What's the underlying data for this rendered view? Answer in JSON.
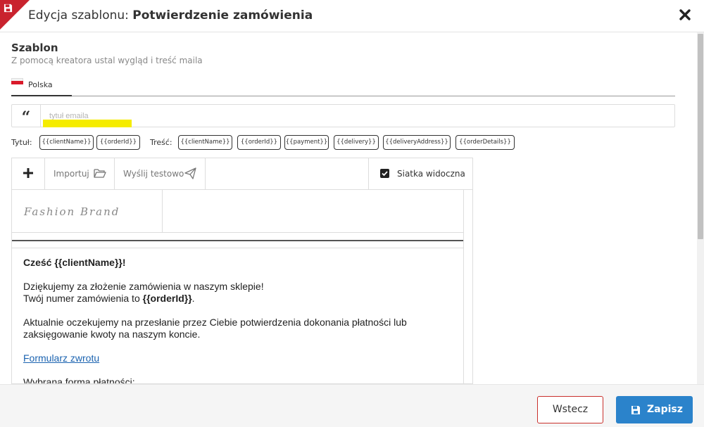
{
  "header": {
    "title_prefix": "Edycja szablonu:",
    "title_name": "Potwierdzenie zamówienia",
    "corner_icon": "save-icon",
    "close_icon": "close-icon"
  },
  "section": {
    "title": "Szablon",
    "subtitle": "Z pomocą kreatora ustal wygląd i treść maila"
  },
  "tabs": [
    {
      "label": "Polska",
      "flag": "flag-pl-icon",
      "active": true
    }
  ],
  "subject": {
    "icon": "quote-icon",
    "placeholder": "tytuł emaila",
    "value": ""
  },
  "variables": {
    "title_label": "Tytuł:",
    "title_vars": [
      "{{clientName}}",
      "{{orderId}}"
    ],
    "body_label": "Treść:",
    "body_vars": [
      "{{clientName}}",
      "{{orderId}}",
      "{{payment}}",
      "{{delivery}}",
      "{{deliveryAddress}}",
      "{{orderDetails}}"
    ]
  },
  "toolbar": {
    "add_icon": "plus-icon",
    "import_label": "Importuj",
    "import_icon": "folder-open-icon",
    "send_test_label": "Wyślij testowo",
    "send_test_icon": "paper-plane-icon",
    "grid_label": "Siatka widoczna",
    "grid_checked": true
  },
  "email": {
    "logo_text": "Fashion Brand",
    "greeting_prefix": "Cześć ",
    "greeting_var": "{{clientName}}",
    "greeting_suffix": "!",
    "thanks_line": "Dziękujemy za złożenie zamówienia w naszym sklepie!",
    "order_prefix": "Twój numer zamówienia to ",
    "order_var": "{{orderId}}",
    "order_suffix": ".",
    "payment_para": "Aktualnie oczekujemy na przesłanie przez Ciebie potwierdzenia dokonania płatności lub zaksięgowanie kwoty na naszym koncie.",
    "return_link": "Formularz zwrotu",
    "payment_label": "Wybrana forma płatności:"
  },
  "footer": {
    "back_label": "Wstecz",
    "save_label": "Zapisz",
    "save_icon": "save-icon"
  },
  "colors": {
    "accent_red": "#c9232e",
    "primary_blue": "#2b83cb",
    "link_blue": "#1b63b0",
    "highlight_yellow": "#f5ec00"
  }
}
